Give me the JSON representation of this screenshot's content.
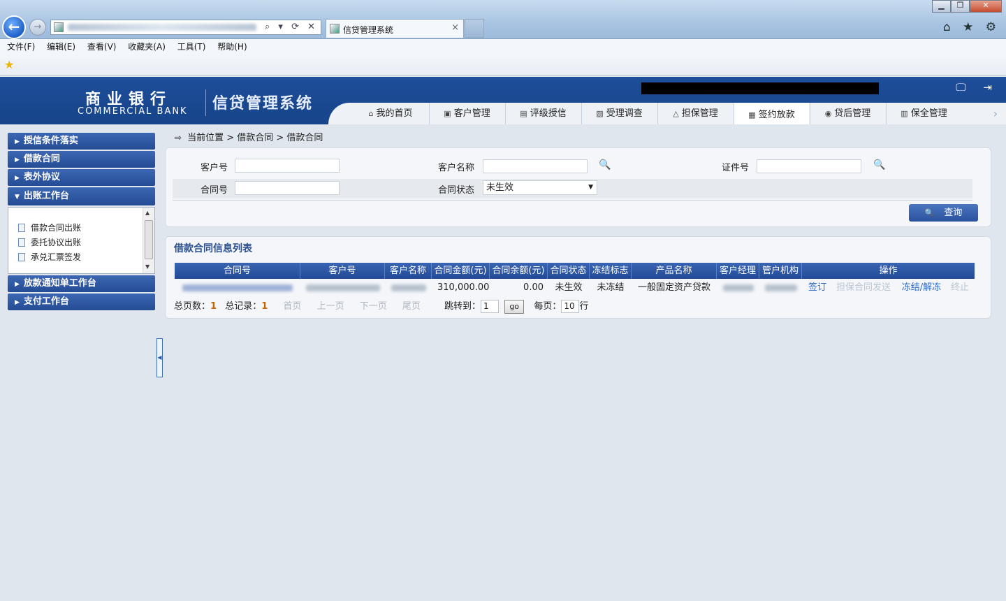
{
  "browser": {
    "tab_title": "信贷管理系统",
    "tab_close": "×",
    "back_glyph": "←",
    "forward_glyph": "→",
    "address_tools": "⌕ ▾ ⟳ ✕",
    "right_icons": "⌂ ★ ⚙",
    "window_buttons": {
      "minimize": "▁",
      "maximize": "❐",
      "close": "✕"
    },
    "menu": [
      "文件(F)",
      "编辑(E)",
      "查看(V)",
      "收藏夹(A)",
      "工具(T)",
      "帮助(H)"
    ],
    "favorites_icon": "star-icon"
  },
  "header": {
    "logo_cn": "商业银行",
    "logo_en": "COMMERCIAL BANK",
    "system_title": "信贷管理系统",
    "icons": "🖵 ⇥",
    "tabs": [
      {
        "label": "我的首页",
        "icon": "⌂"
      },
      {
        "label": "客户管理",
        "icon": "▣"
      },
      {
        "label": "评级授信",
        "icon": "▤"
      },
      {
        "label": "受理调查",
        "icon": "▧"
      },
      {
        "label": "担保管理",
        "icon": "△"
      },
      {
        "label": "签约放款",
        "icon": "▦"
      },
      {
        "label": "贷后管理",
        "icon": "◉"
      },
      {
        "label": "保全管理",
        "icon": "▥"
      }
    ],
    "active_tab": "签约放款",
    "more_arrow": "›"
  },
  "sidebar": {
    "sections": [
      {
        "label": "授信条件落实",
        "arrow": "▶"
      },
      {
        "label": "借款合同",
        "arrow": "▶"
      },
      {
        "label": "表外协议",
        "arrow": "▶"
      },
      {
        "label": "出账工作台",
        "arrow": "▼"
      },
      {
        "label": "放款通知单工作台",
        "arrow": "▶"
      },
      {
        "label": "支付工作台",
        "arrow": "▶"
      }
    ],
    "expanded_items": [
      "借款合同出账",
      "委托协议出账",
      "承兑汇票签发"
    ],
    "scroll_up": "▲",
    "scroll_down": "▼",
    "collapse_glyph": "◀"
  },
  "breadcrumb": {
    "icon": "⇨",
    "text": "当前位置 > 借款合同 > 借款合同"
  },
  "search": {
    "customer_no_label": "客户号",
    "customer_name_label": "客户名称",
    "id_no_label": "证件号",
    "contract_no_label": "合同号",
    "contract_status_label": "合同状态",
    "contract_status_value": "未生效",
    "search_glyph": "🔍",
    "query_button": "查询",
    "query_icon": "🔍"
  },
  "list": {
    "title": "借款合同信息列表",
    "columns": [
      "合同号",
      "客户号",
      "客户名称",
      "合同金额(元)",
      "合同余额(元)",
      "合同状态",
      "冻结标志",
      "产品名称",
      "客户经理",
      "管户机构",
      "操作"
    ],
    "row": {
      "amount": "310,000.00",
      "balance": "0.00",
      "status": "未生效",
      "freeze": "未冻结",
      "product": "一般固定资产贷款",
      "actions": [
        "签订",
        "担保合同发送",
        "冻结/解冻",
        "终止"
      ]
    },
    "pager": {
      "total_pages_label": "总页数：",
      "total_pages": "1",
      "total_records_label": "总记录：",
      "total_records": "1",
      "first": "首页",
      "prev": "上一页",
      "next": "下一页",
      "last": "尾页",
      "jump_label": "跳转到：",
      "jump_value": "1",
      "go": "go",
      "per_page_label": "每页：",
      "per_page": "10",
      "rows_unit": "行"
    }
  }
}
